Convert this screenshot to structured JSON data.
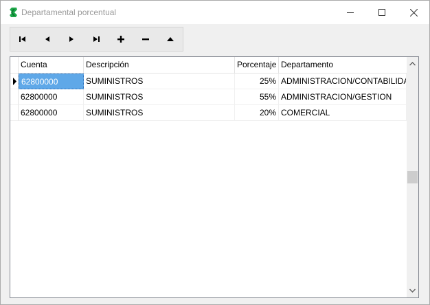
{
  "window": {
    "title": "Departamental porcentual",
    "app_icon": "green-dollar-icon",
    "controls": [
      "minimize-icon",
      "maximize-icon",
      "close-icon"
    ]
  },
  "navigator": {
    "buttons": [
      {
        "name": "first-record-button",
        "icon": "first-icon"
      },
      {
        "name": "prior-record-button",
        "icon": "prior-icon"
      },
      {
        "name": "next-record-button",
        "icon": "next-icon"
      },
      {
        "name": "last-record-button",
        "icon": "last-icon"
      },
      {
        "name": "insert-record-button",
        "icon": "plus-icon"
      },
      {
        "name": "delete-record-button",
        "icon": "minus-icon"
      },
      {
        "name": "edit-record-button",
        "icon": "up-arrow-icon"
      }
    ]
  },
  "grid": {
    "columns": [
      "Cuenta",
      "Descripción",
      "Porcentaje",
      "Departamento"
    ],
    "rows": [
      {
        "cuenta": "62800000",
        "descripcion": "SUMINISTROS",
        "porcentaje": "25%",
        "departamento": "ADMINISTRACION/CONTABILIDAD",
        "current": true
      },
      {
        "cuenta": "62800000",
        "descripcion": "SUMINISTROS",
        "porcentaje": "55%",
        "departamento": "ADMINISTRACION/GESTION",
        "current": false
      },
      {
        "cuenta": "62800000",
        "descripcion": "SUMINISTROS",
        "porcentaje": "20%",
        "departamento": "COMERCIAL",
        "current": false
      }
    ]
  },
  "colors": {
    "selected_cell": "#5fa8e8",
    "app_icon": "#1fa84a"
  }
}
